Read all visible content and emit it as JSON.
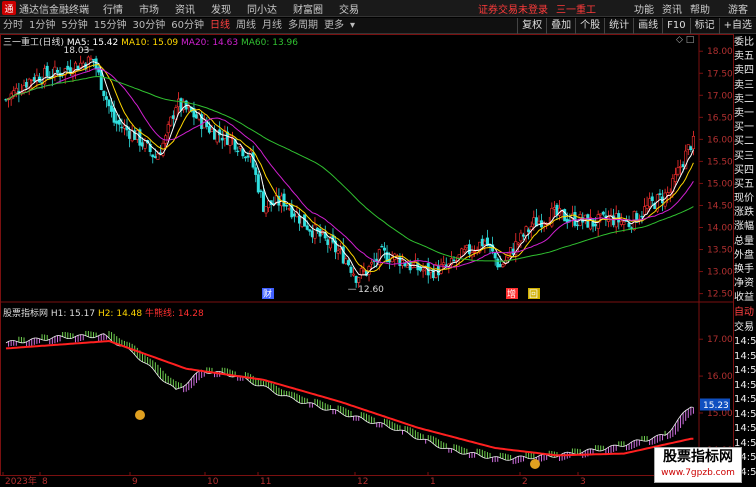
{
  "menubar": {
    "app_title": "通达信金融终端",
    "items": [
      "行情",
      "市场",
      "资讯",
      "发现",
      "同小达",
      "财富圈",
      "交易"
    ],
    "warning": "证券交易未登录",
    "stock": "三一重工",
    "right": [
      "功能",
      "资讯",
      "帮助",
      "游客"
    ]
  },
  "periods": [
    "分时",
    "1分钟",
    "5分钟",
    "15分钟",
    "30分钟",
    "60分钟",
    "日线",
    "周线",
    "月线",
    "多周期",
    "更多"
  ],
  "active_period": "日线",
  "toolbar": [
    "复权",
    "叠加",
    "个股",
    "统计",
    "画线",
    "F10",
    "标记",
    "+自选"
  ],
  "main_chart": {
    "stock_label": "三一重工(日线)",
    "ma": [
      {
        "name": "MA5",
        "value": "15.42",
        "color": "#ffffff"
      },
      {
        "name": "MA10",
        "value": "15.09",
        "color": "#ffd700"
      },
      {
        "name": "MA20",
        "value": "14.63",
        "color": "#d020d0"
      },
      {
        "name": "MA60",
        "value": "13.96",
        "color": "#30c030"
      }
    ],
    "high_label": "18.03",
    "low_label": "12.60",
    "markers": [
      "财",
      "增",
      "回"
    ],
    "y_ticks": [
      "18.00",
      "17.50",
      "17.00",
      "16.50",
      "16.00",
      "15.50",
      "15.00",
      "14.50",
      "14.00",
      "13.50",
      "13.00",
      "12.50"
    ]
  },
  "indicator": {
    "name": "股票指标网",
    "h1_label": "H1:",
    "h1": "15.17",
    "h2_label": "H2:",
    "h2": "14.48",
    "line_label": "牛熊线",
    "line_value": "14.28",
    "y_ticks": [
      "17.00",
      "16.00",
      "15.00",
      "14.00"
    ],
    "current": "15.23"
  },
  "x_axis": [
    "2023年",
    "8",
    "9",
    "10",
    "11",
    "12",
    "1",
    "2",
    "3"
  ],
  "sidebar_top": [
    "委比",
    "卖五",
    "卖四",
    "卖三",
    "卖二",
    "卖一",
    "买一",
    "买二",
    "买三",
    "买四",
    "买五",
    "现价",
    "涨跌",
    "涨幅",
    "总量",
    "外盘",
    "换手",
    "净资",
    "收益"
  ],
  "sidebar_bottom": [
    "自动",
    "交易",
    "14:5",
    "14:5",
    "14:5",
    "14:5",
    "14:5",
    "14:5",
    "14:5",
    "14:5",
    "14:5",
    "14:5"
  ],
  "watermark": {
    "title": "股票指标网",
    "url": "www.7gpzb.com"
  },
  "colors": {
    "up": "#ff3030",
    "down": "#30e0e0",
    "ma5": "#ffffff",
    "ma10": "#ffd700",
    "ma20": "#d020d0",
    "ma60": "#30c030",
    "h_up": "#d070e0",
    "h_down": "#70d050",
    "bull": "#ff2020"
  }
}
